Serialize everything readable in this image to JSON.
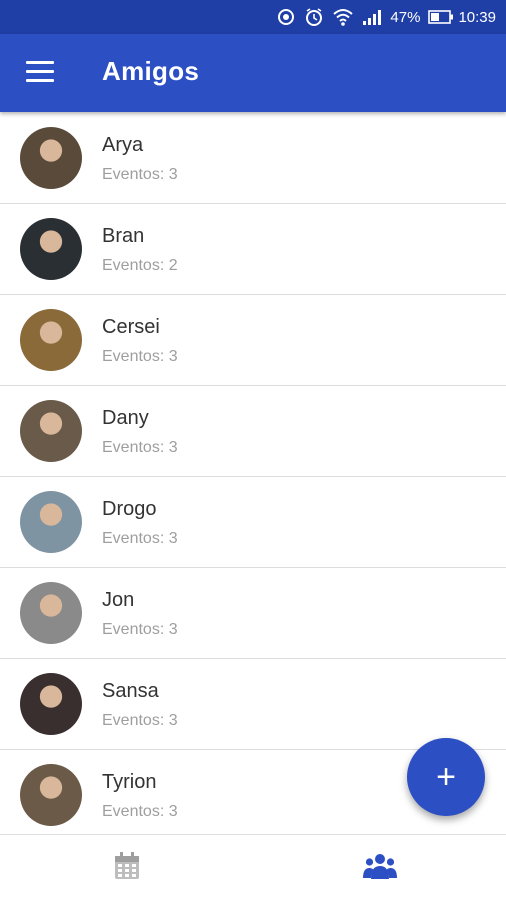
{
  "status_bar": {
    "battery": "47%",
    "time": "10:39",
    "icons": [
      "sync-icon",
      "alarm-icon",
      "wifi-icon",
      "signal-icon",
      "battery-icon"
    ]
  },
  "app_bar": {
    "title": "Amigos",
    "menu_icon": "hamburger-menu-icon"
  },
  "friends": [
    {
      "name": "Arya",
      "events": "Eventos: 3",
      "avatar_color": "#5a4a3a"
    },
    {
      "name": "Bran",
      "events": "Eventos: 2",
      "avatar_color": "#2a2f33"
    },
    {
      "name": "Cersei",
      "events": "Eventos: 3",
      "avatar_color": "#8b6a3a"
    },
    {
      "name": "Dany",
      "events": "Eventos: 3",
      "avatar_color": "#6a5a4a"
    },
    {
      "name": "Drogo",
      "events": "Eventos: 3",
      "avatar_color": "#7f94a3"
    },
    {
      "name": "Jon",
      "events": "Eventos: 3",
      "avatar_color": "#8a8a8a"
    },
    {
      "name": "Sansa",
      "events": "Eventos: 3",
      "avatar_color": "#3a2f2f"
    },
    {
      "name": "Tyrion",
      "events": "Eventos: 3",
      "avatar_color": "#6b5a48"
    }
  ],
  "fab": {
    "label": "+",
    "icon": "add-icon"
  },
  "bottom_nav": {
    "items": [
      {
        "icon": "calendar-icon",
        "active": false
      },
      {
        "icon": "group-icon",
        "active": true
      }
    ]
  },
  "colors": {
    "primary": "#2d4fc4",
    "status_bar": "#1f3fa6",
    "nav_inactive": "#bdbdbd",
    "nav_active": "#2d4fc4"
  }
}
